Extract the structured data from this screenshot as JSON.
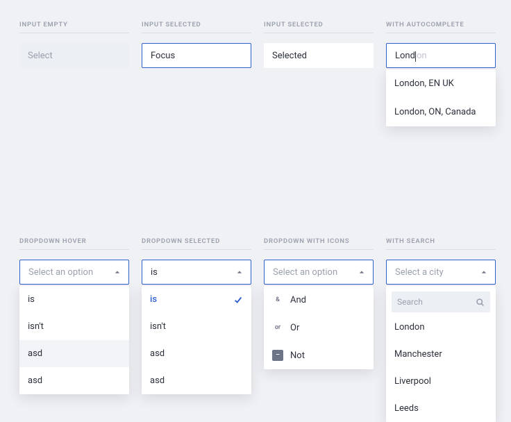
{
  "row1": {
    "empty": {
      "caption": "INPUT EMPTY",
      "placeholder": "Select"
    },
    "selected1": {
      "caption": "INPUT SELECTED",
      "value": "Focus"
    },
    "selected2": {
      "caption": "INPUT SELECTED",
      "value": "Selected"
    },
    "auto": {
      "caption": "WITH AUTOCOMPLETE",
      "typed": "Lond",
      "ghost": "on",
      "options": [
        "London, EN UK",
        "London, ON, Canada"
      ]
    }
  },
  "row2": {
    "hover": {
      "caption": "DROPDOWN HOVER",
      "placeholder": "Select an option",
      "options": [
        "is",
        "isn't",
        "asd",
        "asd"
      ],
      "hover_index": 2
    },
    "sel": {
      "caption": "DROPDOWN SELECTED",
      "value": "is",
      "options": [
        "is",
        "isn't",
        "asd",
        "asd"
      ],
      "selected_index": 0
    },
    "icons": {
      "caption": "DROPDOWN WITH ICONS",
      "placeholder": "Select an option",
      "options": [
        {
          "icon": "&",
          "label": "And"
        },
        {
          "icon": "or",
          "label": "Or"
        },
        {
          "icon": "–",
          "label": "Not",
          "boxed": true
        }
      ]
    },
    "search": {
      "caption": "WITH SEARCH",
      "placeholder": "Select a city",
      "search_ph": "Search",
      "options": [
        "London",
        "Manchester",
        "Liverpool",
        "Leeds"
      ]
    }
  }
}
